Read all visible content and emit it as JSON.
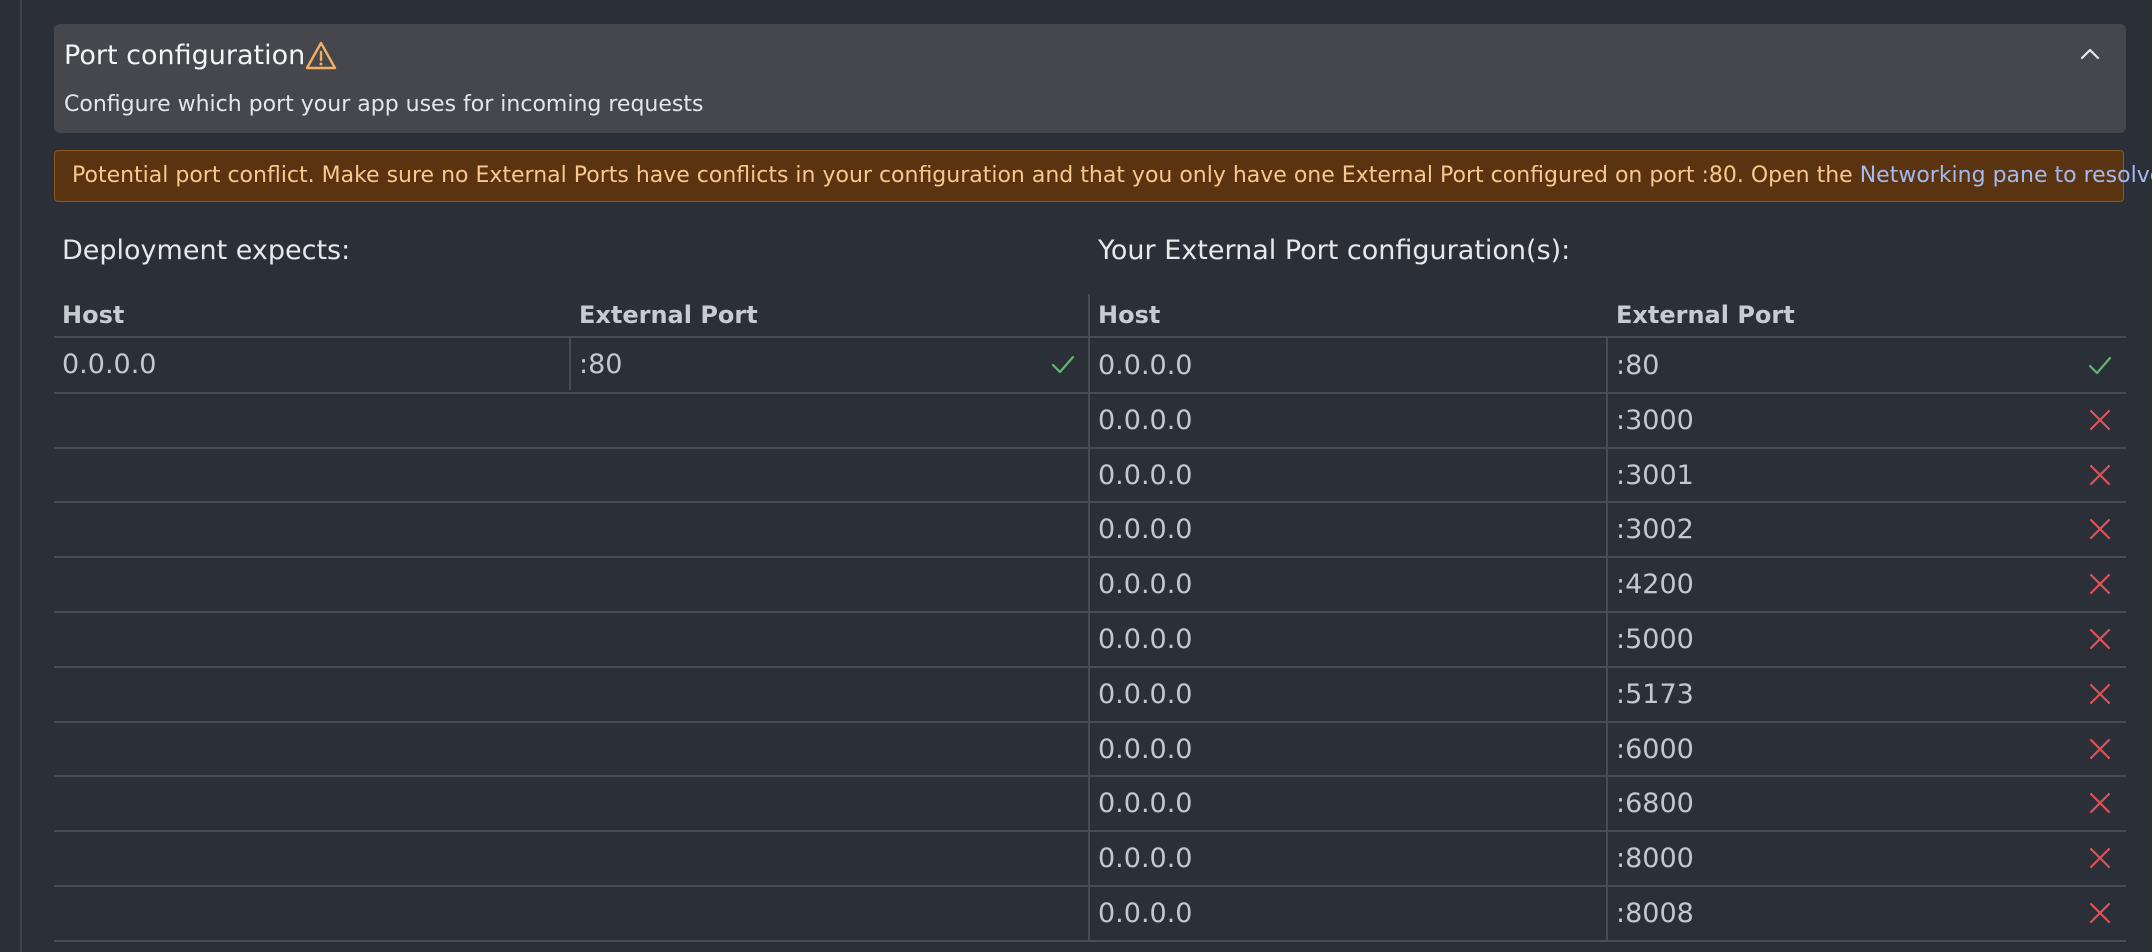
{
  "header": {
    "title": "Port configuration",
    "subtitle": "Configure which port your app uses for incoming requests",
    "warning_icon": "warning-triangle-icon",
    "collapse_icon": "chevron-up-icon"
  },
  "banner": {
    "text": "Potential port conflict. Make sure no External Ports have conflicts in your configuration and that you only have one External Port configured on port :80. Open the ",
    "link_text": "Networking pane to resolve",
    "text_end": "."
  },
  "deployment": {
    "title": "Deployment expects:",
    "host_header": "Host",
    "port_header": "External Port",
    "rows": [
      {
        "host": "0.0.0.0",
        "port": ":80",
        "status": "ok"
      }
    ]
  },
  "external": {
    "title": "Your External Port configuration(s):",
    "host_header": "Host",
    "port_header": "External Port",
    "rows": [
      {
        "host": "0.0.0.0",
        "port": ":80",
        "status": "ok"
      },
      {
        "host": "0.0.0.0",
        "port": ":3000",
        "status": "error"
      },
      {
        "host": "0.0.0.0",
        "port": ":3001",
        "status": "error"
      },
      {
        "host": "0.0.0.0",
        "port": ":3002",
        "status": "error"
      },
      {
        "host": "0.0.0.0",
        "port": ":4200",
        "status": "error"
      },
      {
        "host": "0.0.0.0",
        "port": ":5000",
        "status": "error"
      },
      {
        "host": "0.0.0.0",
        "port": ":5173",
        "status": "error"
      },
      {
        "host": "0.0.0.0",
        "port": ":6000",
        "status": "error"
      },
      {
        "host": "0.0.0.0",
        "port": ":6800",
        "status": "error"
      },
      {
        "host": "0.0.0.0",
        "port": ":8000",
        "status": "error"
      },
      {
        "host": "0.0.0.0",
        "port": ":8008",
        "status": "error"
      }
    ]
  },
  "colors": {
    "ok": "#5fb96a",
    "error": "#e0505a",
    "warning": "#f0b060",
    "link": "#a5b8f0"
  }
}
